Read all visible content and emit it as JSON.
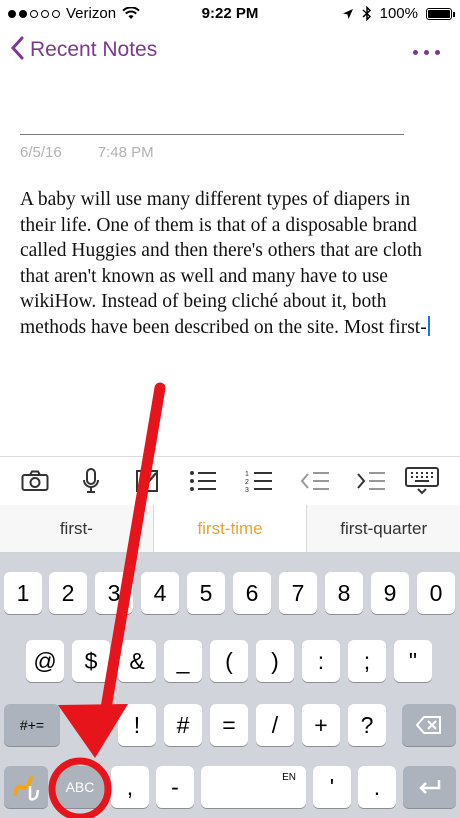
{
  "status_bar": {
    "carrier": "Verizon",
    "time": "9:22 PM",
    "battery": "100%",
    "battery_level": 1.0
  },
  "nav": {
    "back_label": "Recent Notes",
    "more_icon": "more-icon"
  },
  "note": {
    "date": "6/5/16",
    "time": "7:48 PM",
    "body": "A baby will use many different types of diapers in their life. One of them is that of a disposable brand called Huggies and then there's others that are cloth that aren't known as well and many have to use wikiHow. Instead of being cliché about it, both methods have been described on the site. Most first-"
  },
  "toolbar": {
    "icons": [
      "camera-icon",
      "microphone-icon",
      "checkbox-icon",
      "bulleted-list-icon",
      "numbered-list-icon",
      "outdent-icon",
      "indent-icon",
      "keyboard-hide-icon"
    ]
  },
  "suggestions": [
    "first-",
    "first-time",
    "first-quarter"
  ],
  "keyboard": {
    "row1": [
      "1",
      "2",
      "3",
      "4",
      "5",
      "6",
      "7",
      "8",
      "9",
      "0"
    ],
    "row2": [
      "@",
      "$",
      "&",
      "_",
      "(",
      ")",
      ":",
      ";",
      "\""
    ],
    "row3": [
      "!",
      "#",
      "=",
      "/",
      "+",
      "?"
    ],
    "symbols_key": "#+=",
    "abc_key": "ABC",
    "comma_key": ",",
    "dash_key": "-",
    "space_label": "EN",
    "apostrophe_key": "'",
    "period_key": "."
  },
  "colors": {
    "accent": "#7a3b8a",
    "suggestion_highlight": "#e8a431",
    "annotation_red": "#e8141b"
  }
}
